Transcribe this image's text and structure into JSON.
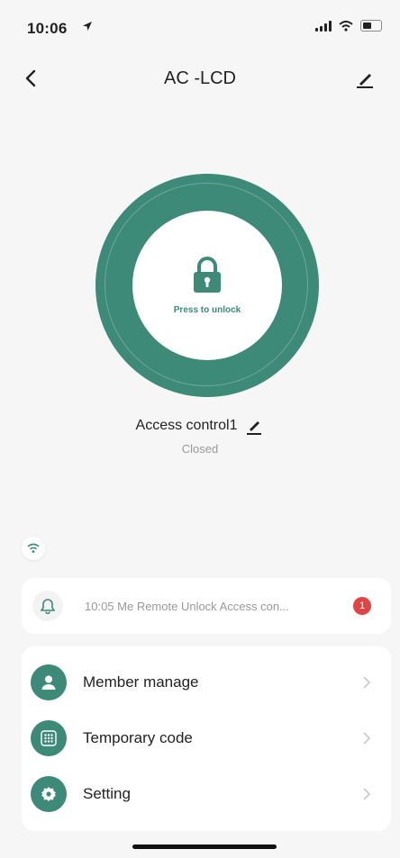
{
  "status_bar": {
    "time": "10:06"
  },
  "header": {
    "title": "AC -LCD"
  },
  "lock": {
    "press_label": "Press to unlock",
    "device_name": "Access control1",
    "status": "Closed"
  },
  "notification": {
    "text": "10:05 Me  Remote Unlock Access con...",
    "badge_count": "1"
  },
  "menu": {
    "items": [
      {
        "label": "Member manage",
        "icon": "person-icon"
      },
      {
        "label": "Temporary code",
        "icon": "keypad-icon"
      },
      {
        "label": "Setting",
        "icon": "gear-icon"
      }
    ]
  },
  "colors": {
    "accent": "#3d8a79",
    "badge": "#e04545",
    "background": "#f6f6f6"
  }
}
